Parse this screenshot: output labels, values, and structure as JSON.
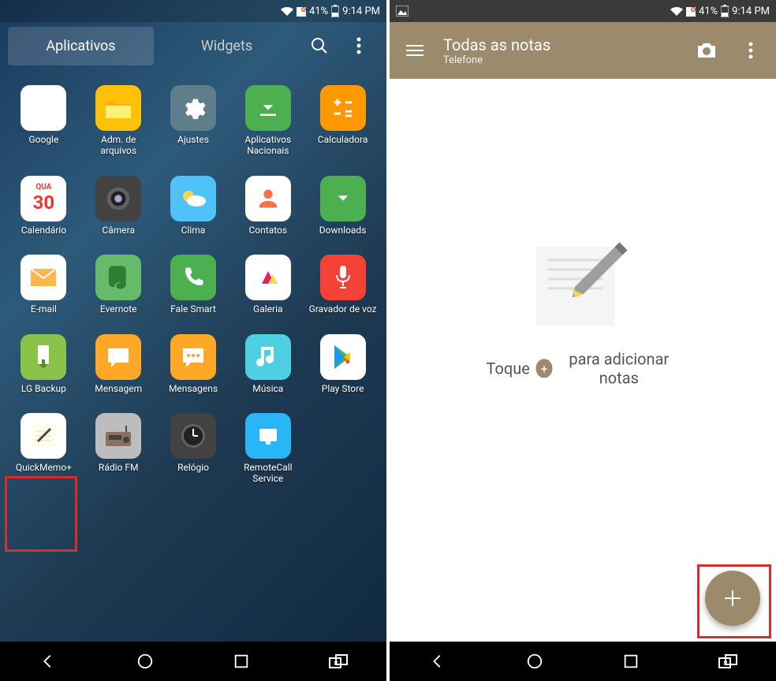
{
  "status": {
    "battery": "41%",
    "time": "9:14 PM"
  },
  "left": {
    "tabs": {
      "apps": "Aplicativos",
      "widgets": "Widgets"
    },
    "apps": [
      {
        "label": "Google",
        "icon": "google"
      },
      {
        "label": "Adm. de arquivos",
        "icon": "folder"
      },
      {
        "label": "Ajustes",
        "icon": "settings"
      },
      {
        "label": "Aplicativos Nacionais",
        "icon": "apps"
      },
      {
        "label": "Calculadora",
        "icon": "calc"
      },
      {
        "label": "Calendário",
        "icon": "calendar"
      },
      {
        "label": "Câmera",
        "icon": "camera"
      },
      {
        "label": "Clima",
        "icon": "weather"
      },
      {
        "label": "Contatos",
        "icon": "contacts"
      },
      {
        "label": "Downloads",
        "icon": "downloads"
      },
      {
        "label": "E-mail",
        "icon": "email"
      },
      {
        "label": "Evernote",
        "icon": "evernote"
      },
      {
        "label": "Fale Smart",
        "icon": "phone"
      },
      {
        "label": "Galeria",
        "icon": "gallery"
      },
      {
        "label": "Gravador de voz",
        "icon": "voice"
      },
      {
        "label": "LG Backup",
        "icon": "backup"
      },
      {
        "label": "Mensagem",
        "icon": "msg"
      },
      {
        "label": "Mensagens",
        "icon": "messages"
      },
      {
        "label": "Música",
        "icon": "music"
      },
      {
        "label": "Play Store",
        "icon": "play"
      },
      {
        "label": "QuickMemo+",
        "icon": "memo"
      },
      {
        "label": "Rádio FM",
        "icon": "radio"
      },
      {
        "label": "Relógio",
        "icon": "clock"
      },
      {
        "label": "RemoteCall Service",
        "icon": "remote"
      }
    ]
  },
  "right": {
    "title": "Todas as notas",
    "subtitle": "Telefone",
    "empty_pre": "Toque",
    "empty_post": "para adicionar notas"
  },
  "calendar": {
    "day": "QUA",
    "date": "30"
  }
}
